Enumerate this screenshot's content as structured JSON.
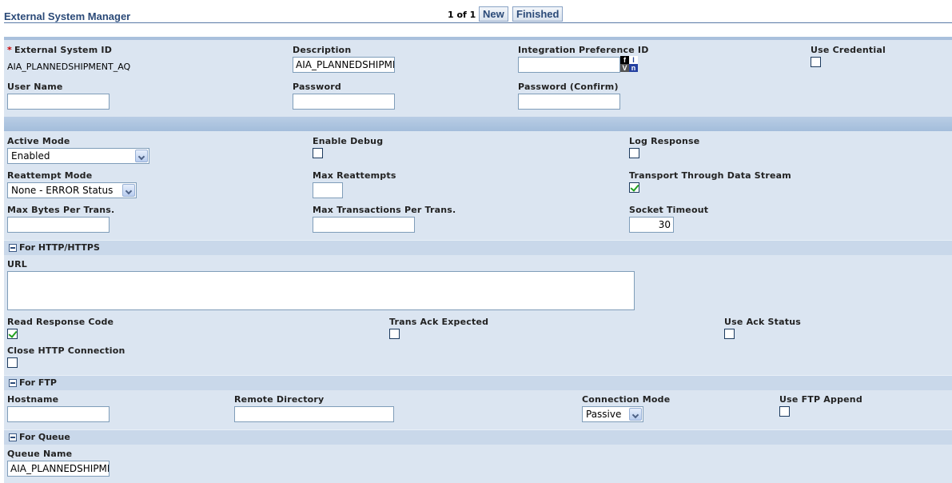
{
  "header": {
    "title": "External System Manager",
    "pager": "1 of 1",
    "new_label": "New",
    "finished_label": "Finished"
  },
  "general": {
    "external_system_id_label": "External System ID",
    "external_system_id_value": "AIA_PLANNEDSHIPMENT_AQ",
    "description_label": "Description",
    "description_value": "AIA_PLANNEDSHIPMENT_AQ",
    "integration_pref_label": "Integration Preference ID",
    "integration_pref_value": "",
    "use_credential_label": "Use Credential",
    "use_credential_checked": false,
    "user_name_label": "User Name",
    "user_name_value": "",
    "password_label": "Password",
    "password_value": "",
    "password_confirm_label": "Password (Confirm)",
    "password_confirm_value": ""
  },
  "transport": {
    "active_mode_label": "Active Mode",
    "active_mode_value": "Enabled",
    "enable_debug_label": "Enable Debug",
    "enable_debug_checked": false,
    "log_response_label": "Log Response",
    "log_response_checked": false,
    "reattempt_mode_label": "Reattempt Mode",
    "reattempt_mode_value": "None - ERROR Status",
    "max_reattempts_label": "Max Reattempts",
    "max_reattempts_value": "",
    "transport_stream_label": "Transport Through Data Stream",
    "transport_stream_checked": true,
    "max_bytes_label": "Max Bytes Per Trans.",
    "max_bytes_value": "",
    "max_trans_label": "Max Transactions Per Trans.",
    "max_trans_value": "",
    "socket_timeout_label": "Socket Timeout",
    "socket_timeout_value": "30"
  },
  "http": {
    "section_title": "For HTTP/HTTPS",
    "url_label": "URL",
    "url_value": "",
    "read_response_label": "Read Response Code",
    "read_response_checked": true,
    "trans_ack_label": "Trans Ack Expected",
    "trans_ack_checked": false,
    "use_ack_label": "Use Ack Status",
    "use_ack_checked": false,
    "close_http_label": "Close HTTP Connection",
    "close_http_checked": false
  },
  "ftp": {
    "section_title": "For FTP",
    "hostname_label": "Hostname",
    "hostname_value": "",
    "remote_dir_label": "Remote Directory",
    "remote_dir_value": "",
    "connection_mode_label": "Connection Mode",
    "connection_mode_value": "Passive",
    "use_ftp_append_label": "Use FTP Append",
    "use_ftp_append_checked": false
  },
  "queue": {
    "section_title": "For Queue",
    "queue_name_label": "Queue Name",
    "queue_name_value": "AIA_PLANNEDSHIPMENT_AQ"
  },
  "icons": {
    "lookup": "flex-field-lookup-icon",
    "collapse": "collapse-minus-icon",
    "dropdown": "chevron-down-icon",
    "checkmark": "checkmark-icon"
  },
  "colors": {
    "panel_bg": "#dbe5f1",
    "section_header_bg": "#c9d8ea",
    "title_color": "#2b4a78",
    "check_color": "#21a121",
    "required_color": "#cc0000"
  }
}
